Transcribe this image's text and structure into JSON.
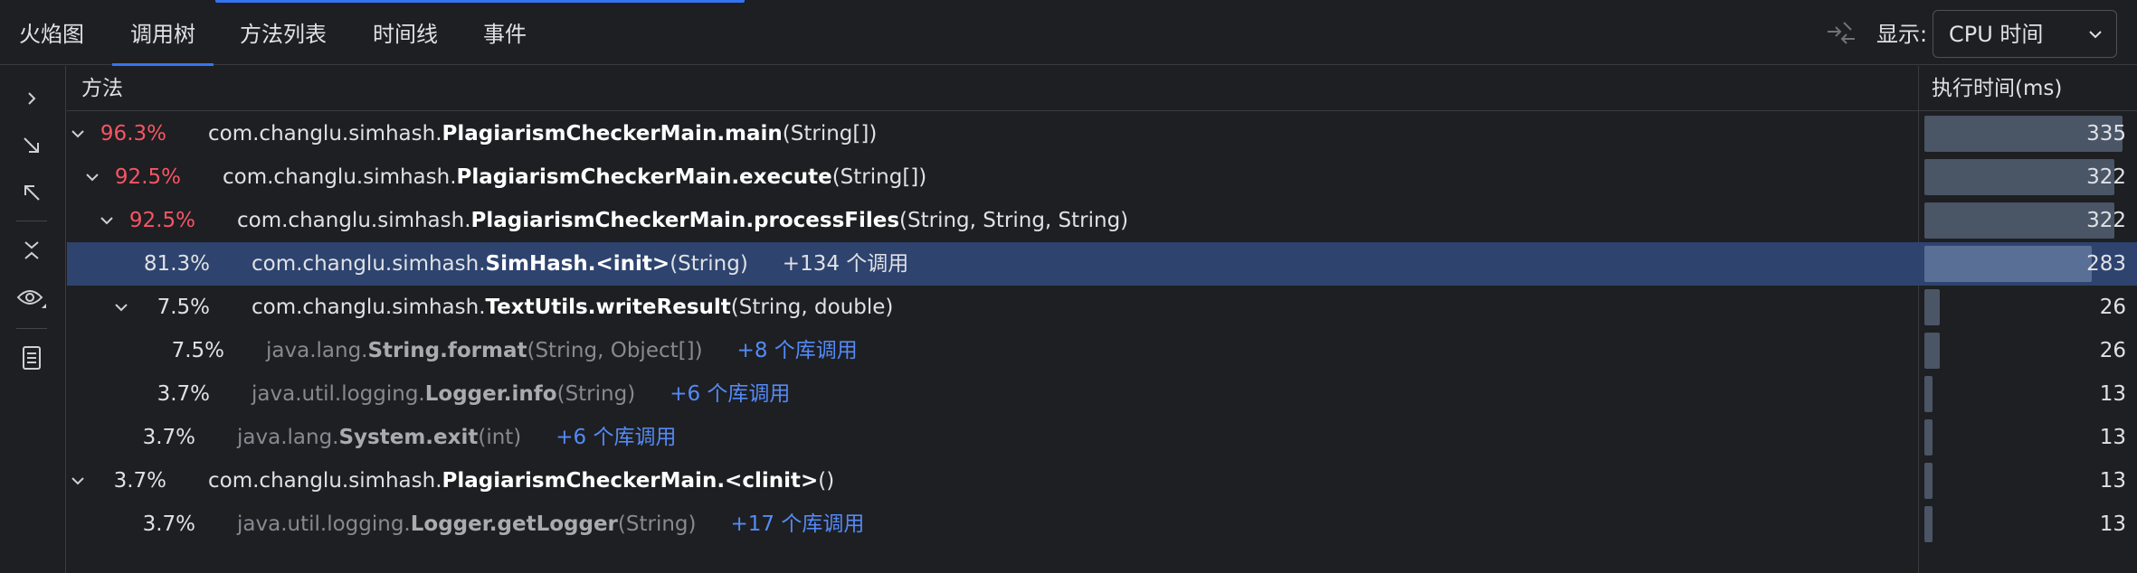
{
  "tabs": [
    {
      "label": "火焰图",
      "active": false
    },
    {
      "label": "调用树",
      "active": true
    },
    {
      "label": "方法列表",
      "active": false
    },
    {
      "label": "时间线",
      "active": false
    },
    {
      "label": "事件",
      "active": false
    }
  ],
  "display": {
    "label": "显示:",
    "selected": "CPU 时间"
  },
  "table": {
    "col_method": "方法",
    "col_time": "执行时间(ms)",
    "rows": [
      {
        "indent": 0,
        "expanded": true,
        "pct": "96.3%",
        "hot": true,
        "pkg": "com.changlu.simhash.",
        "cls": "PlagiarismCheckerMain.main",
        "args": "(String[])",
        "extra": "",
        "lib": false,
        "time": "335",
        "fill": 1.0
      },
      {
        "indent": 1,
        "expanded": true,
        "pct": "92.5%",
        "hot": true,
        "pkg": "com.changlu.simhash.",
        "cls": "PlagiarismCheckerMain.execute",
        "args": "(String[])",
        "extra": "",
        "lib": false,
        "time": "322",
        "fill": 0.96
      },
      {
        "indent": 2,
        "expanded": true,
        "pct": "92.5%",
        "hot": true,
        "pkg": "com.changlu.simhash.",
        "cls": "PlagiarismCheckerMain.processFiles",
        "args": "(String, String, String)",
        "extra": "",
        "lib": false,
        "time": "322",
        "fill": 0.96
      },
      {
        "indent": 3,
        "expanded": false,
        "pct": "81.3%",
        "hot": false,
        "pkg": "com.changlu.simhash.",
        "cls": "SimHash.<init>",
        "args": "(String)",
        "extra": "+134 个调用",
        "extra_plain": true,
        "lib": false,
        "time": "283",
        "fill": 0.845,
        "selected": true
      },
      {
        "indent": 3,
        "expanded": true,
        "pct": "7.5%",
        "hot": false,
        "pkg": "com.changlu.simhash.",
        "cls": "TextUtils.writeResult",
        "args": "(String, double)",
        "extra": "",
        "lib": false,
        "time": "26",
        "fill": 0.078
      },
      {
        "indent": 4,
        "expanded": false,
        "pct": "7.5%",
        "hot": false,
        "pkg": "java.lang.",
        "cls": "String.format",
        "args": "(String, Object[])",
        "extra": "+8 个库调用",
        "lib": true,
        "time": "26",
        "fill": 0.078
      },
      {
        "indent": 3,
        "expanded": false,
        "pct": "3.7%",
        "hot": false,
        "pkg": "java.util.logging.",
        "cls": "Logger.info",
        "args": "(String)",
        "extra": "+6 个库调用",
        "lib": true,
        "time": "13",
        "fill": 0.039
      },
      {
        "indent": 2,
        "expanded": false,
        "pct": "3.7%",
        "hot": false,
        "pkg": "java.lang.",
        "cls": "System.exit",
        "args": "(int)",
        "extra": "+6 个库调用",
        "lib": true,
        "time": "13",
        "fill": 0.039
      },
      {
        "indent": 0,
        "expanded": true,
        "pct": "3.7%",
        "hot": false,
        "pkg": "com.changlu.simhash.",
        "cls": "PlagiarismCheckerMain.<clinit>",
        "args": "()",
        "extra": "",
        "lib": false,
        "time": "13",
        "fill": 0.039
      },
      {
        "indent": 2,
        "expanded": false,
        "pct": "3.7%",
        "hot": false,
        "pkg": "java.util.logging.",
        "cls": "Logger.getLogger",
        "args": "(String)",
        "extra": "+17 个库调用",
        "lib": true,
        "time": "13",
        "fill": 0.039
      }
    ]
  },
  "tools": [
    "chevron-right-icon",
    "expand-all-icon",
    "collapse-all-icon",
    "collapse-icon",
    "eye-icon",
    "list-icon"
  ],
  "colors": {
    "hot": "#f75464",
    "link": "#548af7",
    "accent": "#3574f0",
    "selected_row": "#2e436e"
  }
}
